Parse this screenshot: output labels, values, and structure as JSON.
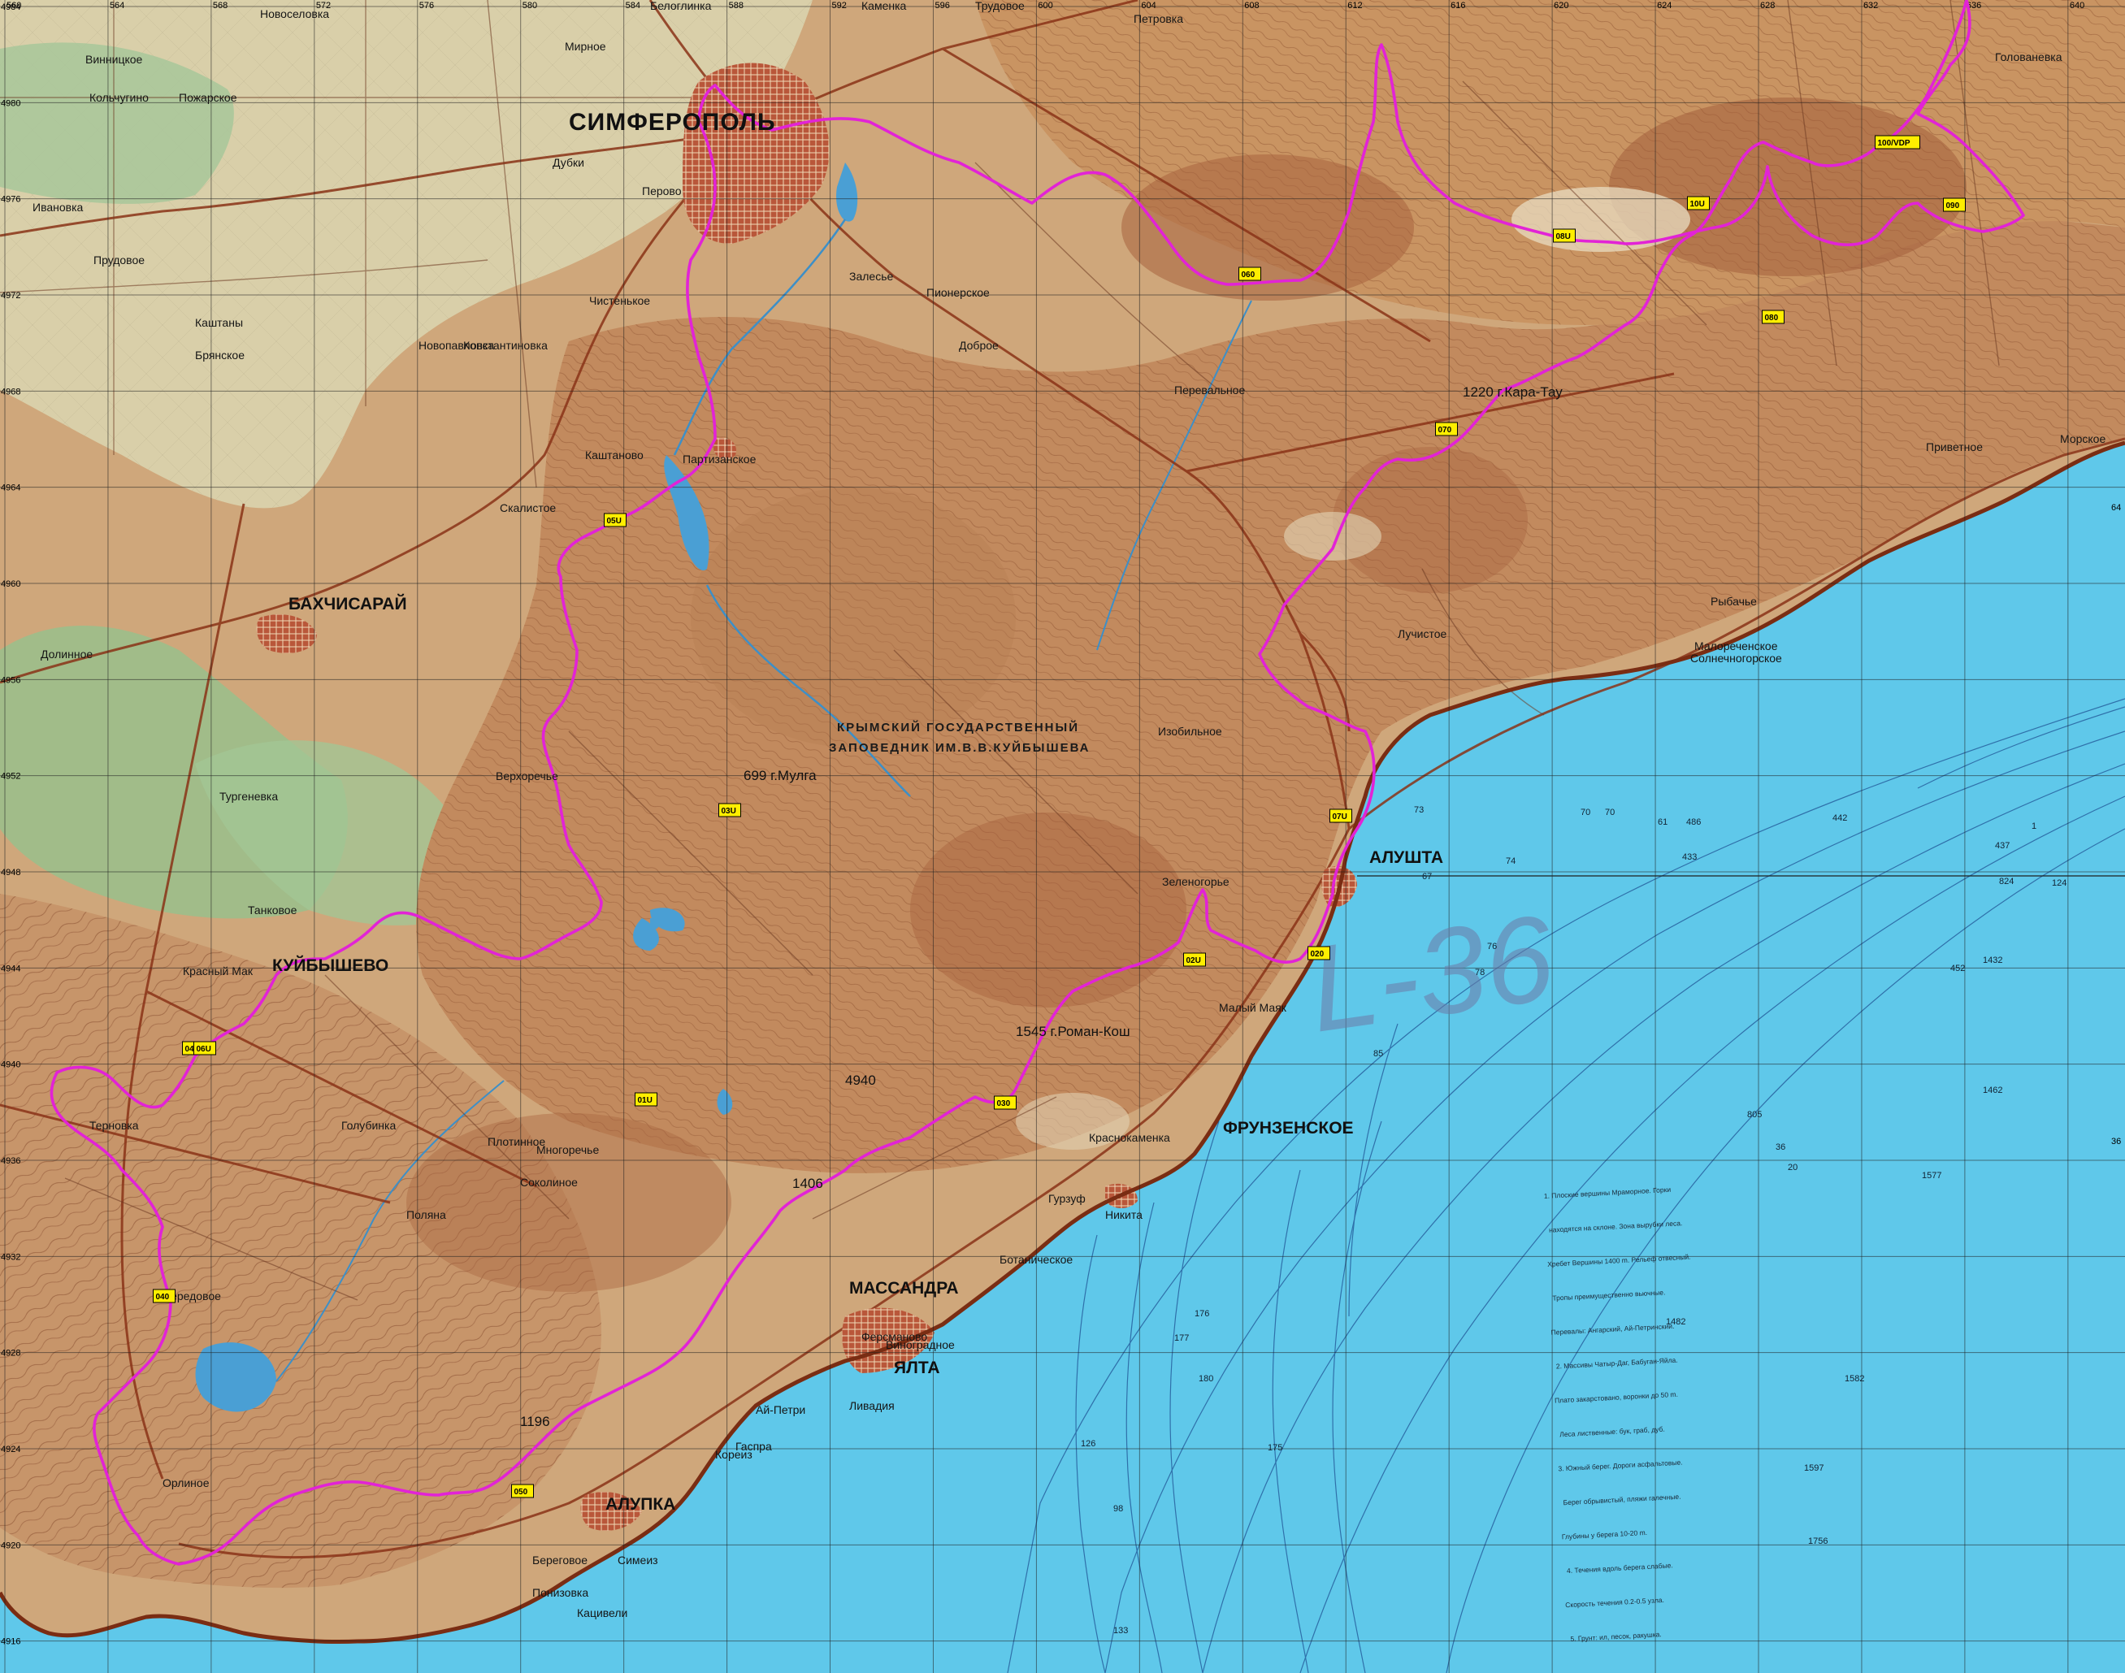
{
  "colors": {
    "sea": "#5fc8ea",
    "land_low": "#d4c79f",
    "land_mid": "#c99a6c",
    "land_high": "#b1704b",
    "forest": "#8fb58a",
    "route": "#e223d6",
    "roads": "#7a2d13",
    "water_body": "#4a9fd4",
    "grid": "#1f1f1f",
    "town_fill": "#9a3a20"
  },
  "icons": [
    "waypoint-marker-icon"
  ],
  "sheet_label": "L-36",
  "cities": [
    {
      "name": "СИМФЕРОПОЛЬ",
      "cls": "lbl-city"
    },
    {
      "name": "АЛУШТА",
      "cls": "lbl-town"
    },
    {
      "name": "ЯЛТА",
      "cls": "lbl-town"
    },
    {
      "name": "БАХЧИСАРАЙ",
      "cls": "lbl-town"
    },
    {
      "name": "АЛУПКА",
      "cls": "lbl-town"
    },
    {
      "name": "ФРУНЗЕНСКОЕ",
      "cls": "lbl-town"
    },
    {
      "name": "КУЙБЫШЕВО",
      "cls": "lbl-town"
    },
    {
      "name": "МАССАНДРА",
      "cls": "lbl-town"
    }
  ],
  "villages": [
    "Новоселовка",
    "Белоглинка",
    "Мирное",
    "Каменка",
    "Трудовое",
    "Петровка",
    "Винницкое",
    "Кольчугино",
    "Пожарское",
    "Дубки",
    "Перово",
    "Ивановка",
    "Прудовое",
    "Каштаны",
    "Брянское",
    "Новопавловка",
    "Каштаново",
    "Партизанское",
    "Скалистое",
    "Долинное",
    "Тургеневка",
    "Танковое",
    "Красный Мак",
    "Терновка",
    "Голубинка",
    "Верхоречье",
    "Соколиное",
    "Плотинное",
    "Орлиное",
    "Передовое",
    "Пионерское",
    "Залесье",
    "Перевальное",
    "Изобильное",
    "Малый Маяк",
    "Рыбачье",
    "Малореченское",
    "Солнечногорское",
    "Приветное",
    "Морское",
    "Голованевка",
    "Лучистое",
    "Зеленогорье",
    "Ливадия",
    "Береговое",
    "Понизовка",
    "Кацивели",
    "Симеиз",
    "Гаспра",
    "Кореиз",
    "Гурзуф",
    "Никита",
    "Краснокаменка",
    "Виноградное",
    "Ботаническое",
    "Чистенькое",
    "Доброе",
    "Ферсманово",
    "Константиновка",
    "Многоречье",
    "Поляна",
    "Ай-Петри"
  ],
  "peaks": [
    "1545 г.Роман-Кош",
    "1220 г.Кара-Тау",
    "699 г.Мулга",
    "1406",
    "1196",
    "4940"
  ],
  "reserve": [
    "КРЫМСКИЙ ГОСУДАРСТВЕННЫЙ",
    "ЗАПОВЕДНИК ИМ.В.В.КУЙБЫШЕВА"
  ],
  "grid": {
    "top_labels": [
      "560",
      "564",
      "568",
      "572",
      "576",
      "580",
      "584",
      "588",
      "592",
      "596",
      "600",
      "604",
      "608",
      "612",
      "616",
      "620",
      "624",
      "628",
      "632",
      "636",
      "640"
    ],
    "left_labels": [
      "4984",
      "4980",
      "4976",
      "4972",
      "4968",
      "4964",
      "4960",
      "4956",
      "4952",
      "4948",
      "4944",
      "4940",
      "4936",
      "4932",
      "4928",
      "4924",
      "4920",
      "4916"
    ],
    "right_labels": [
      "64",
      "36"
    ]
  },
  "waypoints": [
    {
      "id": "01U"
    },
    {
      "id": "02U"
    },
    {
      "id": "020"
    },
    {
      "id": "03U"
    },
    {
      "id": "030"
    },
    {
      "id": "04U"
    },
    {
      "id": "040"
    },
    {
      "id": "05U"
    },
    {
      "id": "050"
    },
    {
      "id": "06U"
    },
    {
      "id": "060"
    },
    {
      "id": "07U"
    },
    {
      "id": "070"
    },
    {
      "id": "08U"
    },
    {
      "id": "080"
    },
    {
      "id": "090"
    },
    {
      "id": "10U"
    },
    {
      "id": "100/VDP"
    }
  ],
  "depths": [
    "74",
    "76",
    "67",
    "78",
    "73",
    "70",
    "486",
    "433",
    "437",
    "442",
    "452",
    "824",
    "805",
    "1577",
    "1482",
    "1582",
    "1597",
    "1756",
    "1432",
    "1462",
    "70",
    "85",
    "98",
    "133",
    "176",
    "177",
    "180",
    "175",
    "126",
    "20",
    "36",
    "1",
    "61",
    "124"
  ],
  "legend_text": [
    "1. Плоские вершины Мраморное. Горки",
    "находятся на склоне. Зона вырубки леса.",
    "Хребет Вершины 1400 m. Рельеф отвесный.",
    "Тропы преимущественно вьючные.",
    "Перевалы: Ангарский, Ай-Петринский.",
    "2. Массивы Чатыр-Даг, Бабуган-Яйла.",
    "Плато закарстовано, воронки до 50 m.",
    "Леса лиственные: бук, граб, дуб.",
    "3. Южный берег. Дороги асфальтовые.",
    "Берег обрывистый, пляжи галечные.",
    "Глубины у берега 10-20 m.",
    "4. Течения вдоль берега слабые.",
    "Скорость течения 0.2-0.5 узла.",
    "5. Грунт: ил, песок, ракушка."
  ]
}
